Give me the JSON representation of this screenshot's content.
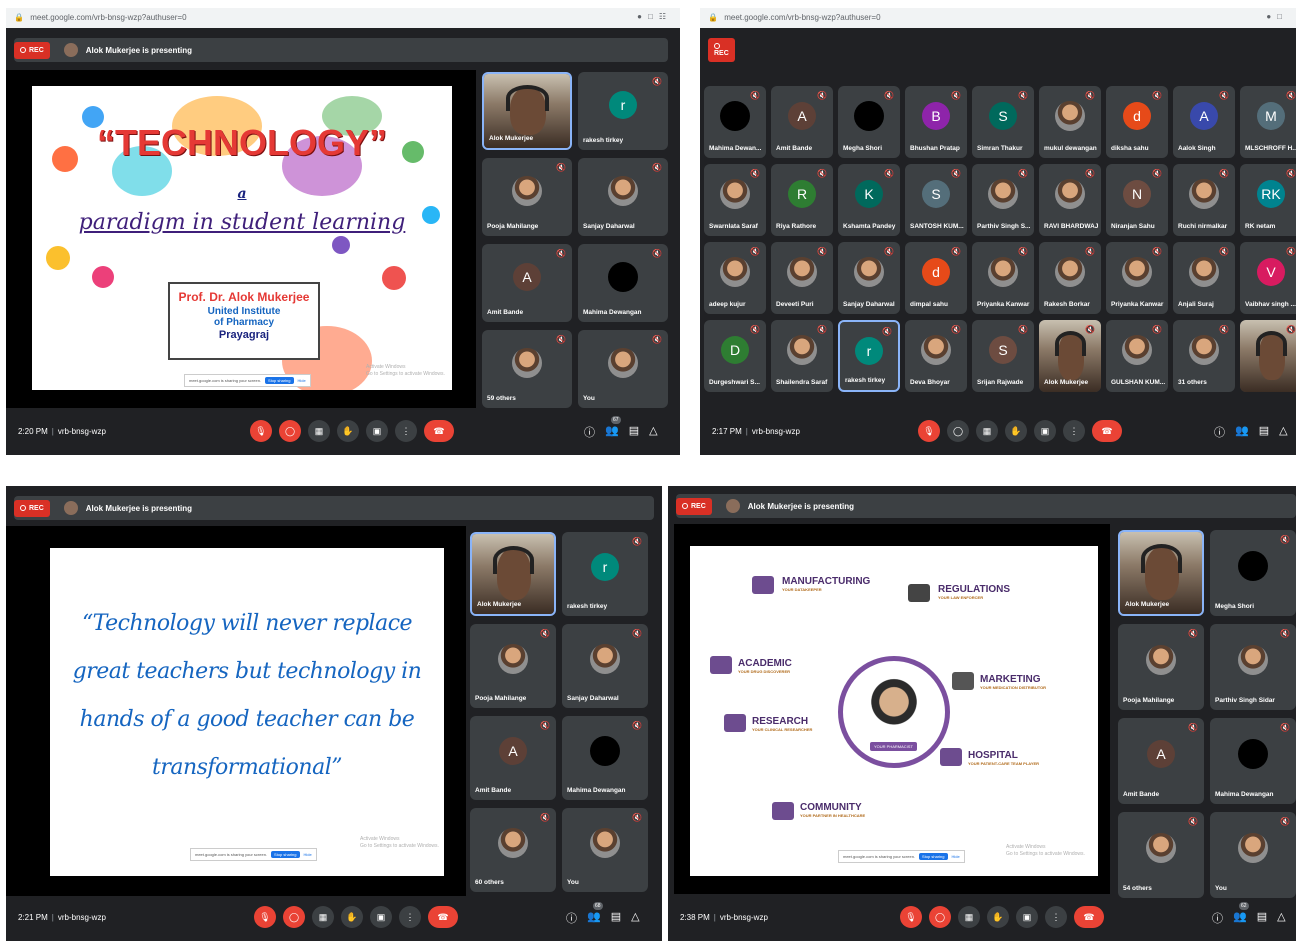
{
  "panel1": {
    "url": "meet.google.com/vrb-bnsg-wzp?authuser=0",
    "rec_label": "REC",
    "presenting": "Alok Mukerjee is presenting",
    "slide": {
      "title": "“TECHNOLOGY”",
      "a": "a",
      "subtitle": "paradigm in student learning",
      "presenter": "Prof. Dr. Alok Mukerjee",
      "inst1": "United Institute",
      "inst2": "of Pharmacy",
      "city": "Prayagraj",
      "share_text": "meet.google.com is sharing your screen.",
      "stop_label": "Stop sharing",
      "hide_label": "Hide",
      "watermark1": "Activate Windows",
      "watermark2": "Go to Settings to activate Windows."
    },
    "tiles": [
      {
        "name": "Alok Mukerjee"
      },
      {
        "name": "rakesh tirkey",
        "initial": "r",
        "color": "#00897b"
      },
      {
        "name": "Pooja Mahilange"
      },
      {
        "name": "Sanjay Daharwal"
      },
      {
        "name": "Amit Bande",
        "initial": "A",
        "color": "#5d4037"
      },
      {
        "name": "Mahima Dewangan"
      },
      {
        "name": "59 others"
      },
      {
        "name": "You"
      }
    ],
    "time": "2:20 PM",
    "code": "vrb-bnsg-wzp",
    "people_count": "67"
  },
  "panel2": {
    "url": "meet.google.com/vrb-bnsg-wzp?authuser=0",
    "rec_label": "REC",
    "grid": [
      {
        "name": "Mahima Dewan...",
        "type": "dark"
      },
      {
        "name": "Amit Bande",
        "initial": "A",
        "color": "#5d4037"
      },
      {
        "name": "Megha Shori",
        "type": "dark"
      },
      {
        "name": "Bhushan Pratap",
        "initial": "B",
        "color": "#8e24aa"
      },
      {
        "name": "Simran Thakur",
        "initial": "S",
        "color": "#00695c"
      },
      {
        "name": "mukul dewangan",
        "type": "photo"
      },
      {
        "name": "diksha sahu",
        "initial": "d",
        "color": "#e64a19"
      },
      {
        "name": "Aalok Singh",
        "initial": "A",
        "color": "#3949ab"
      },
      {
        "name": "MLSCHROFF H...",
        "initial": "M",
        "color": "#546e7a"
      },
      {
        "name": "Swarnlata Saraf",
        "type": "photo"
      },
      {
        "name": "Riya Rathore",
        "initial": "R",
        "color": "#2e7d32"
      },
      {
        "name": "Kshamta Pandey",
        "initial": "K",
        "color": "#00695c"
      },
      {
        "name": "SANTOSH KUM...",
        "initial": "S",
        "color": "#546e7a"
      },
      {
        "name": "Parthiv Singh S...",
        "type": "photo"
      },
      {
        "name": "RAVI BHARDWAJ",
        "type": "photo"
      },
      {
        "name": "Niranjan Sahu",
        "initial": "N",
        "color": "#6d4c41"
      },
      {
        "name": "Ruchi nirmalkar",
        "type": "photo"
      },
      {
        "name": "RK netam",
        "initial": "RK",
        "color": "#00838f"
      },
      {
        "name": "adeep kujur",
        "type": "photo"
      },
      {
        "name": "Deveeti Puri",
        "type": "photo"
      },
      {
        "name": "Sanjay Daharwal",
        "type": "photo"
      },
      {
        "name": "dimpal sahu",
        "initial": "d",
        "color": "#e64a19"
      },
      {
        "name": "Priyanka Kanwar",
        "type": "photo"
      },
      {
        "name": "Rakesh Borkar",
        "type": "photo"
      },
      {
        "name": "Priyanka Kanwar",
        "type": "photo"
      },
      {
        "name": "Anjali Suraj",
        "type": "photo"
      },
      {
        "name": "Vaibhav singh ...",
        "initial": "V",
        "color": "#d81b60"
      },
      {
        "name": "Durgeshwari S...",
        "initial": "D",
        "color": "#2e7d32"
      },
      {
        "name": "Shailendra Saraf",
        "type": "photo"
      },
      {
        "name": "rakesh tirkey",
        "initial": "r",
        "color": "#00897b"
      },
      {
        "name": "Deva Bhoyar",
        "type": "photo"
      },
      {
        "name": "Srijan Rajwade",
        "initial": "S",
        "color": "#6d4c41"
      },
      {
        "name": "Alok Mukerjee",
        "type": "cam"
      },
      {
        "name": "GULSHAN KUM...",
        "type": "photo"
      },
      {
        "name": "31 others",
        "type": "photo"
      },
      {
        "name": "",
        "type": "cam"
      }
    ],
    "time": "2:17 PM",
    "code": "vrb-bnsg-wzp"
  },
  "panel3": {
    "rec_label": "REC",
    "presenting": "Alok Mukerjee is presenting",
    "quote": "“Technology will never replace great teachers but technology in hands of a good teacher can be transformational”",
    "share_text": "meet.google.com is sharing your screen.",
    "stop_label": "Stop sharing",
    "hide_label": "Hide",
    "watermark1": "Activate Windows",
    "watermark2": "Go to Settings to activate Windows.",
    "tiles": [
      {
        "name": "Alok Mukerjee"
      },
      {
        "name": "rakesh tirkey",
        "initial": "r",
        "color": "#00897b"
      },
      {
        "name": "Pooja Mahilange"
      },
      {
        "name": "Sanjay Daharwal"
      },
      {
        "name": "Amit Bande",
        "initial": "A",
        "color": "#5d4037"
      },
      {
        "name": "Mahima Dewangan"
      },
      {
        "name": "60 others"
      },
      {
        "name": "You"
      }
    ],
    "time": "2:21 PM",
    "code": "vrb-bnsg-wzp",
    "people_count": "68"
  },
  "panel4": {
    "rec_label": "REC",
    "presenting": "Alok Mukerjee is presenting",
    "sections": {
      "manufacturing": {
        "hd": "MANUFACTURING",
        "tag": "YOUR DATAKEEPER"
      },
      "regulations": {
        "hd": "REGULATIONS",
        "tag": "YOUR LAW ENFORCER"
      },
      "academic": {
        "hd": "ACADEMIC",
        "tag": "YOUR DRUG DISCOVERER"
      },
      "marketing": {
        "hd": "MARKETING",
        "tag": "YOUR MEDICATION DISTRIBUTOR"
      },
      "research": {
        "hd": "RESEARCH",
        "tag": "YOUR CLINICAL RESEARCHER"
      },
      "hospital": {
        "hd": "HOSPITAL",
        "tag": "YOUR PATIENT-CARE TEAM PLAYER"
      },
      "community": {
        "hd": "COMMUNITY",
        "tag": "YOUR PARTNER IN HEALTHCARE"
      }
    },
    "center_label": "YOUR PHARMACIST",
    "share_text": "meet.google.com is sharing your screen.",
    "stop_label": "Stop sharing",
    "hide_label": "Hide",
    "watermark1": "Activate Windows",
    "watermark2": "Go to Settings to activate Windows.",
    "tiles": [
      {
        "name": "Alok Mukerjee"
      },
      {
        "name": "Megha Shori"
      },
      {
        "name": "Pooja Mahilange"
      },
      {
        "name": "Parthiv Singh Sidar"
      },
      {
        "name": "Amit Bande",
        "initial": "A",
        "color": "#5d4037"
      },
      {
        "name": "Mahima Dewangan"
      },
      {
        "name": "54 others"
      },
      {
        "name": "You"
      }
    ],
    "time": "2:38 PM",
    "code": "vrb-bnsg-wzp",
    "people_count": "62"
  }
}
